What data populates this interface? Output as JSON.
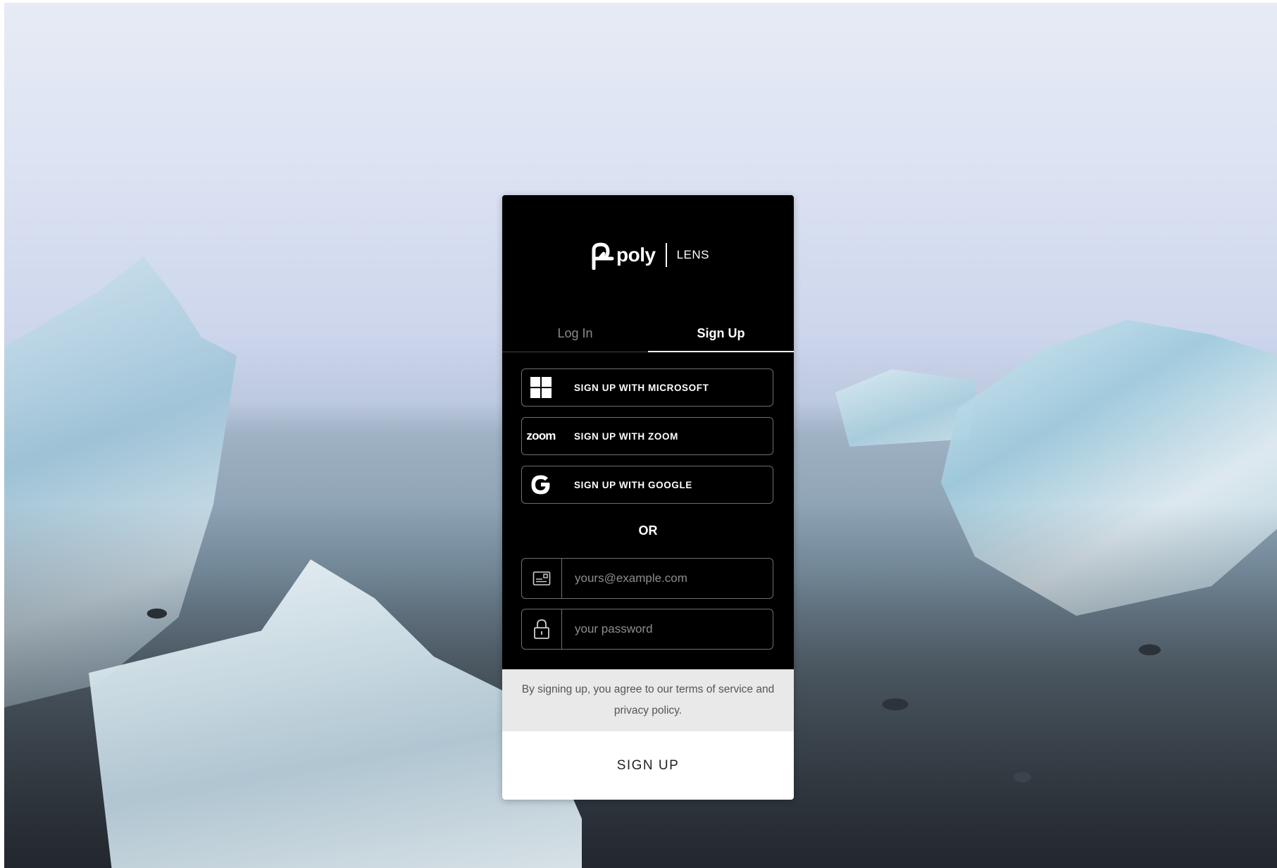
{
  "branding": {
    "logo_word": "poly",
    "product": "LENS"
  },
  "tabs": {
    "login": "Log In",
    "signup": "Sign Up",
    "active": "signup"
  },
  "social_buttons": {
    "microsoft": "SIGN UP WITH MICROSOFT",
    "zoom": "SIGN UP WITH ZOOM",
    "zoom_logo_text": "zoom",
    "google": "SIGN UP WITH GOOGLE"
  },
  "divider": "OR",
  "email": {
    "placeholder": "yours@example.com",
    "icon": "email-card-icon"
  },
  "password": {
    "placeholder": "your password",
    "icon": "lock-icon"
  },
  "terms": {
    "prefix": "By signing up, you agree to our ",
    "tos_link": "terms of service",
    "middle": " and ",
    "privacy_link": "privacy policy",
    "suffix": "."
  },
  "submit_label": "SIGN UP",
  "colors": {
    "panel": "#000000",
    "terms_bg": "#e9e9e9",
    "submit_bg": "#ffffff"
  }
}
